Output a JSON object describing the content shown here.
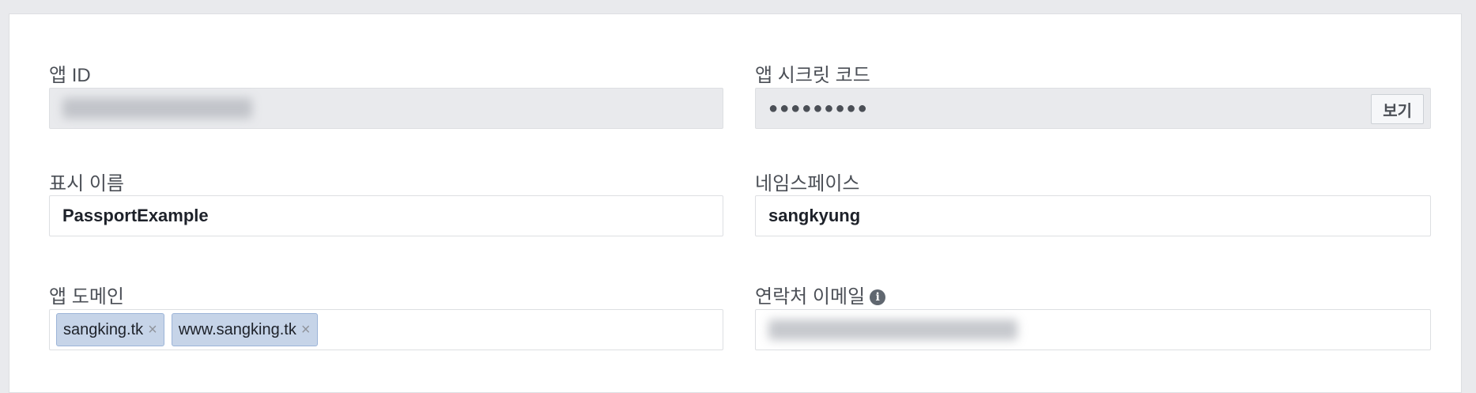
{
  "left": {
    "app_id_label": "앱 ID",
    "display_name_label": "표시 이름",
    "display_name_value": "PassportExample",
    "app_domain_label": "앱 도메인",
    "domains": [
      "sangking.tk",
      "www.sangking.tk"
    ],
    "remove_glyph": "×"
  },
  "right": {
    "secret_label": "앱 시크릿 코드",
    "secret_mask": "●●●●●●●●●",
    "show_button": "보기",
    "namespace_label": "네임스페이스",
    "namespace_value": "sangkyung",
    "email_label": "연락처 이메일",
    "info_glyph": "i"
  }
}
